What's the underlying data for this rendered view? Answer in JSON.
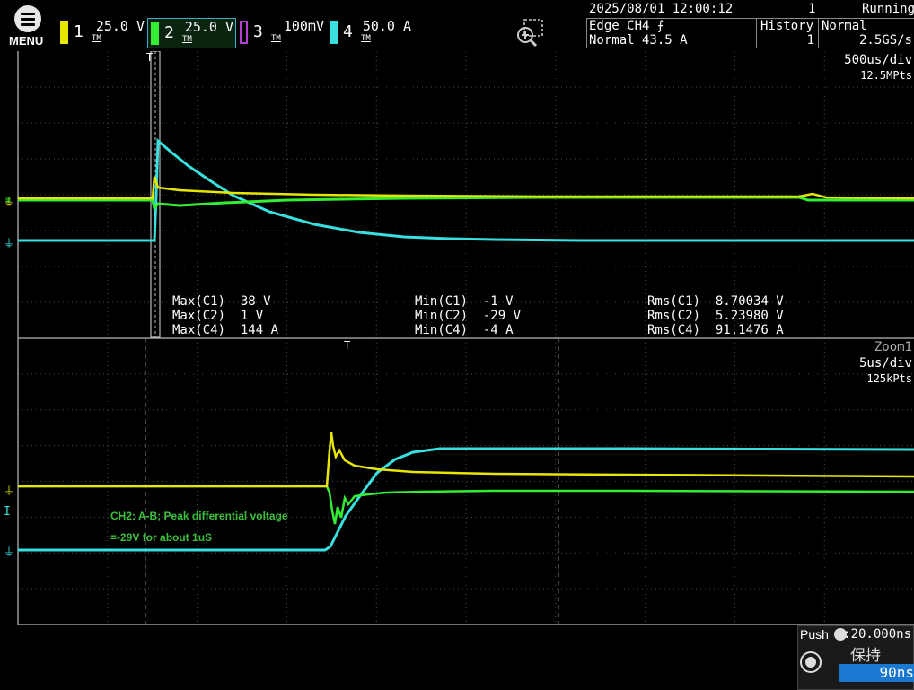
{
  "menu": {
    "label": "MENU"
  },
  "channels": [
    {
      "num": "1",
      "scale": "25.0 V",
      "color": "#e6e600",
      "tm": "TM",
      "active": false
    },
    {
      "num": "2",
      "scale": "25.0 V",
      "color": "#33ee33",
      "tm": "TM",
      "active": true
    },
    {
      "num": "3",
      "scale": "100mV",
      "color": "#b040d0",
      "tm": "TM",
      "active": false
    },
    {
      "num": "4",
      "scale": "50.0 A",
      "color": "#38e0e0",
      "tm": "TM",
      "active": false
    }
  ],
  "status": {
    "datetime": "2025/08/01 12:00:12",
    "count": "1",
    "state": "Running",
    "trigger_type": "Edge CH4",
    "trigger_mode": "Normal 43.5 A",
    "history_label": "History",
    "history_value": "1",
    "acq_mode": "Normal",
    "sample_rate": "2.5GS/s"
  },
  "main_window": {
    "timebase": "500us/div",
    "points": "12.5MPts"
  },
  "zoom_window": {
    "name": "Zoom1",
    "timebase": "5us/div",
    "points": "125kPts"
  },
  "measurements": {
    "col1": [
      "Max(C1)  38 V",
      "Max(C2)  1 V",
      "Max(C4)  144 A"
    ],
    "col2": [
      "Min(C1)  -1 V",
      "Min(C2)  -29 V",
      "Min(C4)  -4 A"
    ],
    "col3": [
      "Rms(C1)  8.70034 V",
      "Rms(C2)  5.23980 V",
      "Rms(C4)  91.1476 A"
    ]
  },
  "annotations": {
    "line1": "CH2: A-B; Peak differential voltage",
    "line2": "=-29V for about 1uS"
  },
  "push_box": {
    "push_label": "Push",
    "value": ":20.000ns",
    "hold_label": "保持",
    "input_value": "90ns"
  },
  "colors": {
    "ch1": "#e6e600",
    "ch2": "#33ee33",
    "ch4": "#38e0e0",
    "grid": "#4a4a4a",
    "frame": "#9a9a9a"
  }
}
